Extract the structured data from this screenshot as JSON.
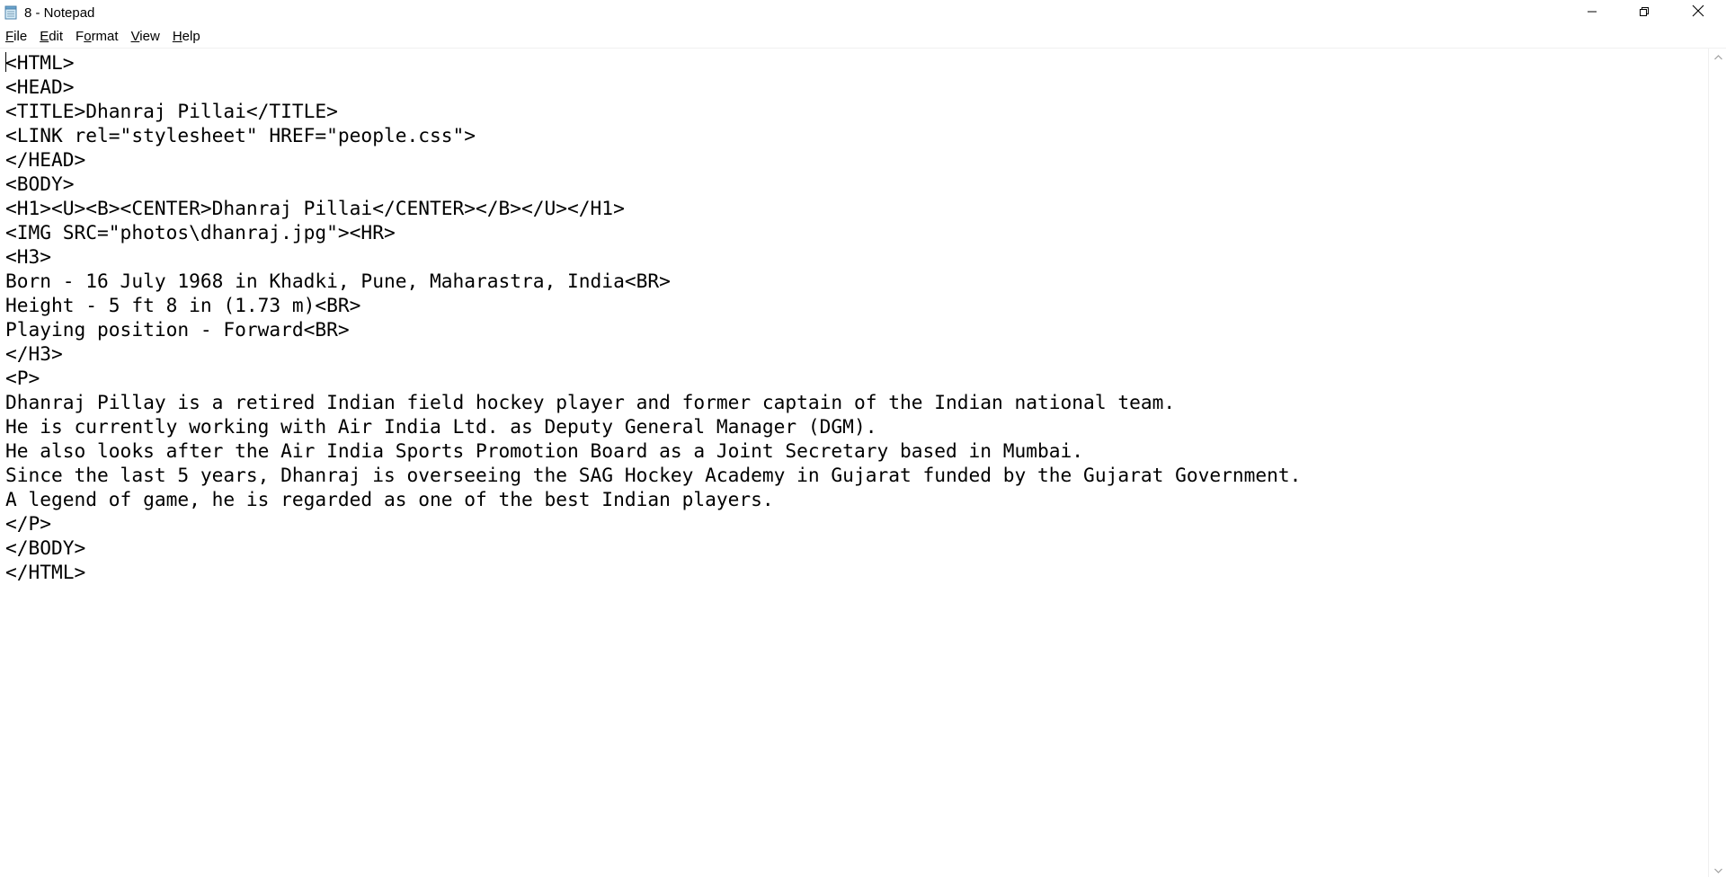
{
  "window": {
    "title": "8 - Notepad"
  },
  "icons": {
    "app": "notepad-icon",
    "minimize": "minimize-icon",
    "maximize": "restore-icon",
    "close": "close-icon",
    "scroll_up": "chevron-up-icon",
    "scroll_down": "chevron-down-icon"
  },
  "menu": [
    {
      "label": "File",
      "accel": "F"
    },
    {
      "label": "Edit",
      "accel": "E"
    },
    {
      "label": "Format",
      "accel": "o"
    },
    {
      "label": "View",
      "accel": "V"
    },
    {
      "label": "Help",
      "accel": "H"
    }
  ],
  "editor": {
    "content": "<HTML>\n<HEAD>\n<TITLE>Dhanraj Pillai</TITLE>\n<LINK rel=\"stylesheet\" HREF=\"people.css\">\n</HEAD>\n<BODY>\n<H1><U><B><CENTER>Dhanraj Pillai</CENTER></B></U></H1>\n<IMG SRC=\"photos\\dhanraj.jpg\"><HR>\n<H3>\nBorn - 16 July 1968 in Khadki, Pune, Maharastra, India<BR>\nHeight - 5 ft 8 in (1.73 m)<BR>\nPlaying position - Forward<BR>\n</H3>\n<P>\nDhanraj Pillay is a retired Indian field hockey player and former captain of the Indian national team.\nHe is currently working with Air India Ltd. as Deputy General Manager (DGM).\nHe also looks after the Air India Sports Promotion Board as a Joint Secretary based in Mumbai.\nSince the last 5 years, Dhanraj is overseeing the SAG Hockey Academy in Gujarat funded by the Gujarat Government.\nA legend of game, he is regarded as one of the best Indian players.\n</P>\n</BODY>\n</HTML>"
  },
  "colors": {
    "background": "#ffffff",
    "text": "#000000",
    "border": "#f0f0f0"
  }
}
